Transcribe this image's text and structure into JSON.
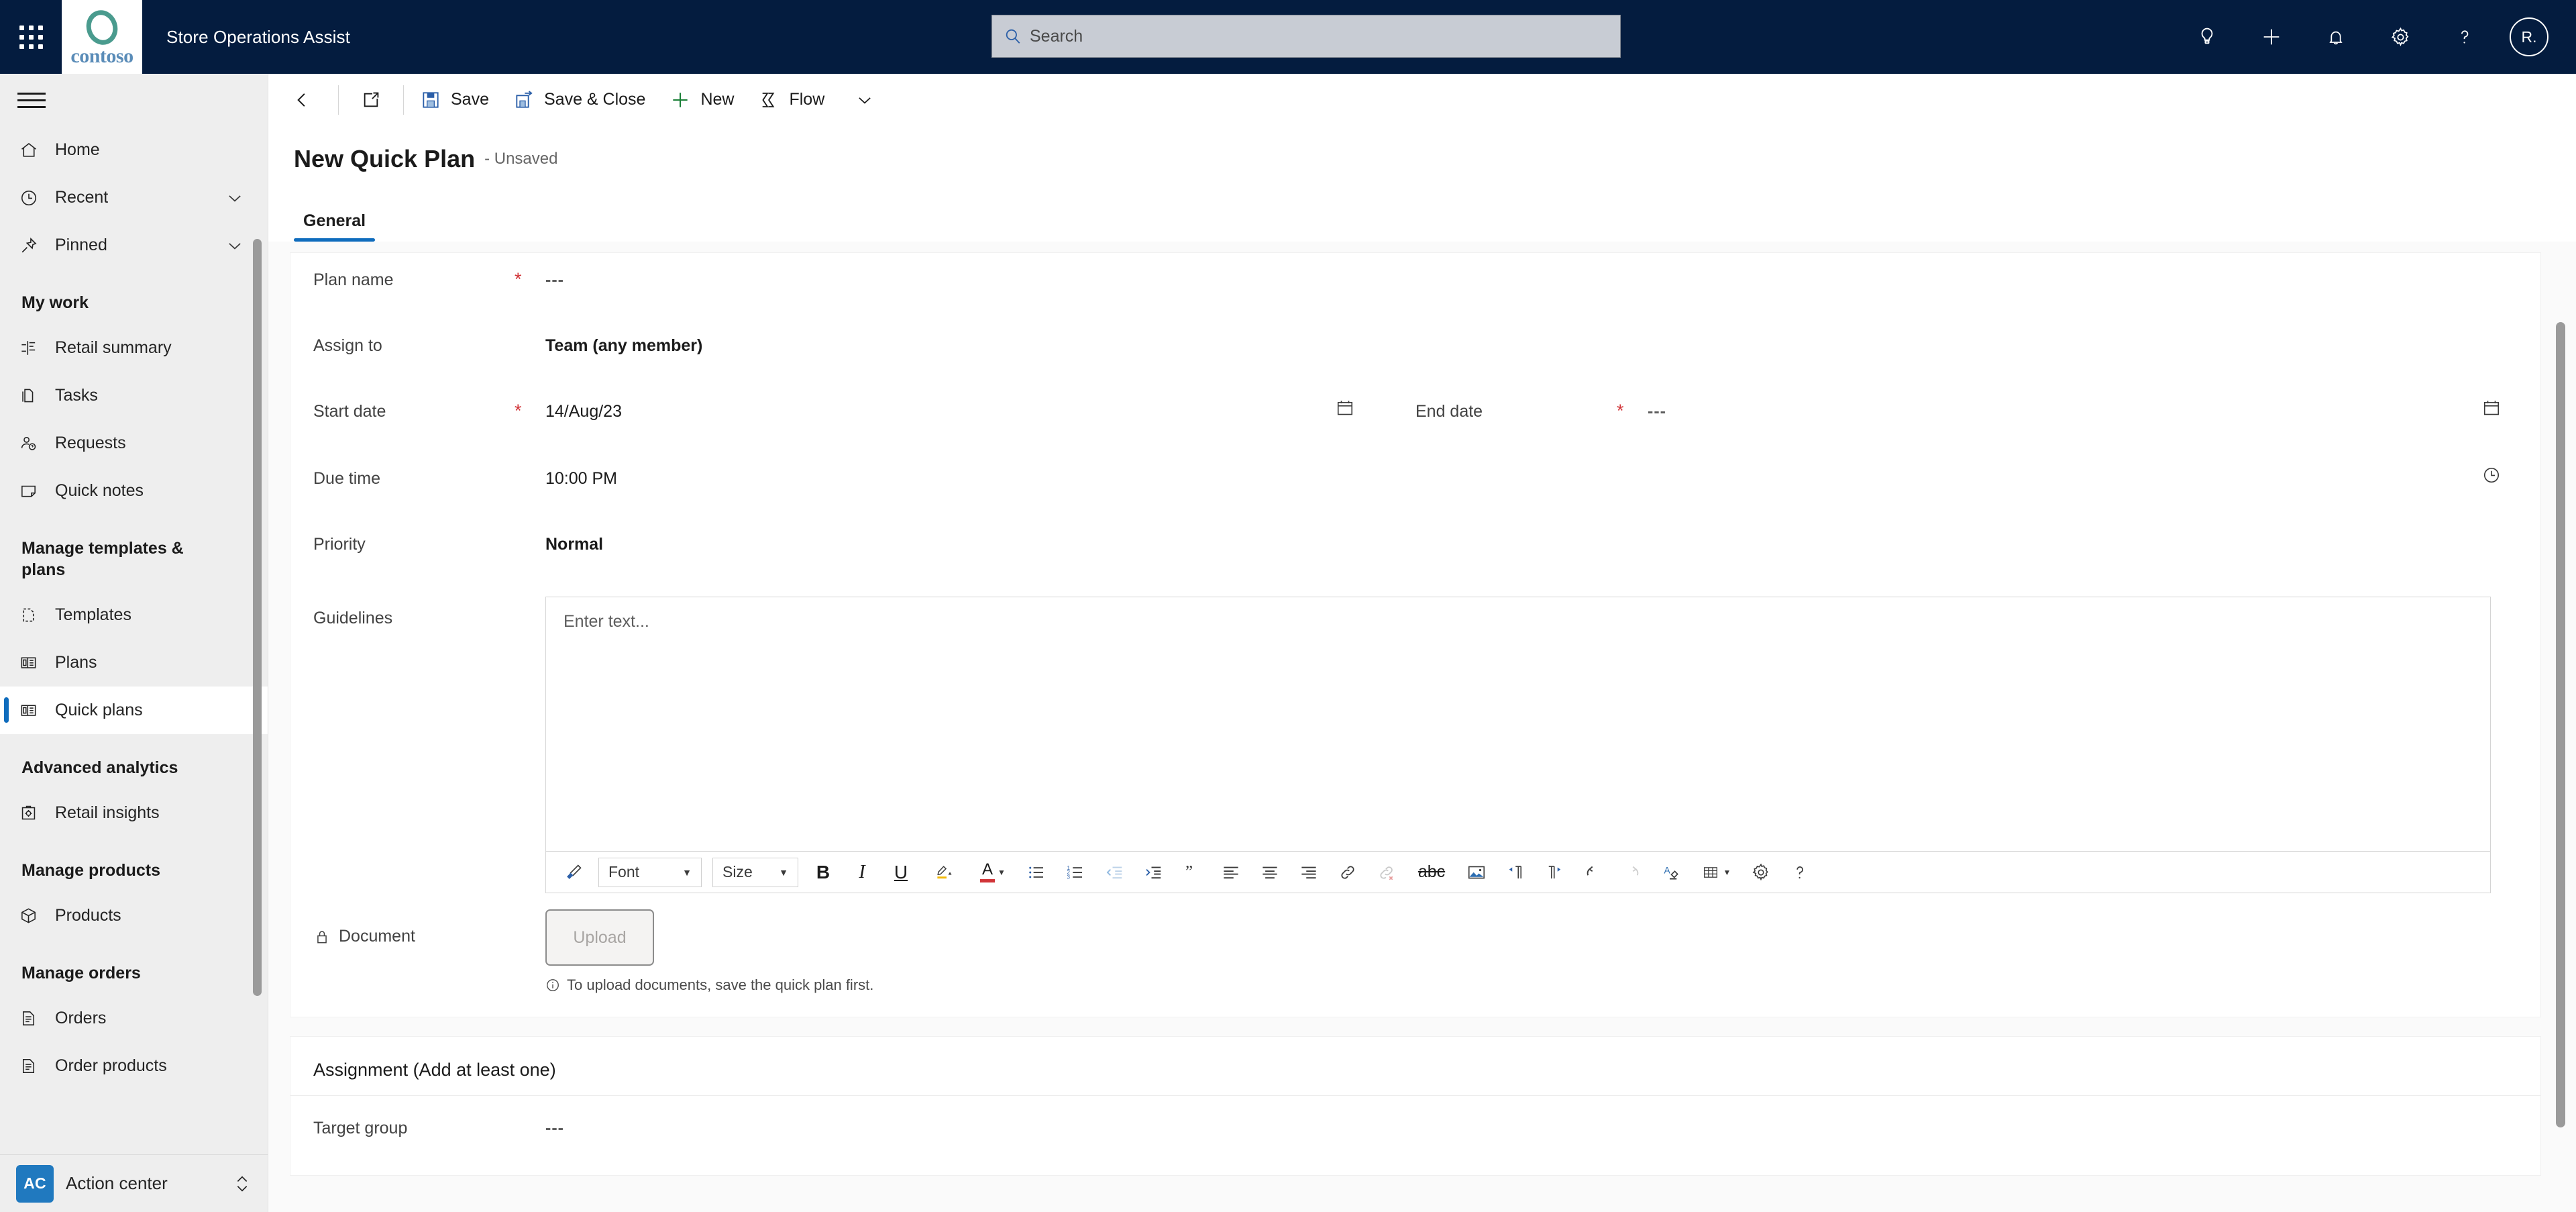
{
  "header": {
    "app_title": "Store Operations Assist",
    "brand_wordmark": "contoso",
    "search_placeholder": "Search",
    "waffle_icon": "app-launcher-icon",
    "search_icon": "search-icon",
    "actions": [
      {
        "name": "lightbulb-icon",
        "label": "Insights"
      },
      {
        "name": "plus-icon",
        "label": "Quick create"
      },
      {
        "name": "bell-icon",
        "label": "Notifications"
      },
      {
        "name": "gear-icon",
        "label": "Settings"
      },
      {
        "name": "question-icon",
        "label": "Help"
      }
    ],
    "avatar_initials": "R."
  },
  "sidebar": {
    "menu_icon": "hamburger-icon",
    "top_items": [
      {
        "label": "Home",
        "icon": "home-icon",
        "expandable": false
      },
      {
        "label": "Recent",
        "icon": "clock-icon",
        "expandable": true
      },
      {
        "label": "Pinned",
        "icon": "pin-icon",
        "expandable": true
      }
    ],
    "groups": [
      {
        "title": "My work",
        "items": [
          {
            "label": "Retail summary",
            "icon": "chart-summary-icon"
          },
          {
            "label": "Tasks",
            "icon": "tasks-icon"
          },
          {
            "label": "Requests",
            "icon": "requests-icon"
          },
          {
            "label": "Quick notes",
            "icon": "note-icon"
          }
        ]
      },
      {
        "title": "Manage templates & plans",
        "items": [
          {
            "label": "Templates",
            "icon": "template-icon"
          },
          {
            "label": "Plans",
            "icon": "plans-icon"
          },
          {
            "label": "Quick plans",
            "icon": "quick-plans-icon",
            "active": true
          }
        ]
      },
      {
        "title": "Advanced analytics",
        "items": [
          {
            "label": "Retail insights",
            "icon": "insights-icon"
          }
        ]
      },
      {
        "title": "Manage products",
        "items": [
          {
            "label": "Products",
            "icon": "box-icon"
          }
        ]
      },
      {
        "title": "Manage orders",
        "items": [
          {
            "label": "Orders",
            "icon": "order-icon"
          },
          {
            "label": "Order products",
            "icon": "order-products-icon"
          }
        ]
      }
    ],
    "action_center": {
      "badge": "AC",
      "label": "Action center",
      "chevron_icon": "chevron-up-down-icon"
    }
  },
  "commandbar": {
    "back_icon": "back-arrow-icon",
    "popout_icon": "open-in-new-window-icon",
    "save_label": "Save",
    "save_icon": "save-floppy-icon",
    "save_close_label": "Save & Close",
    "save_close_icon": "save-and-close-icon",
    "new_label": "New",
    "new_icon": "plus-icon",
    "flow_label": "Flow",
    "flow_icon": "flow-icon",
    "overflow_icon": "chevron-down-icon"
  },
  "page": {
    "title": "New Quick Plan",
    "subtitle": "- Unsaved",
    "tabs": [
      {
        "label": "General",
        "active": true
      }
    ]
  },
  "form": {
    "fields": {
      "plan_name": {
        "label": "Plan name",
        "required": true,
        "value": "---"
      },
      "assign_to": {
        "label": "Assign to",
        "required": false,
        "value": "Team (any member)"
      },
      "start_date": {
        "label": "Start date",
        "required": true,
        "value": "14/Aug/23",
        "icon": "calendar-icon"
      },
      "end_date": {
        "label": "End date",
        "required": true,
        "value": "---",
        "icon": "calendar-icon"
      },
      "due_time": {
        "label": "Due time",
        "required": false,
        "value": "10:00 PM",
        "icon": "clock-icon"
      },
      "priority": {
        "label": "Priority",
        "required": false,
        "value": "Normal"
      },
      "guidelines": {
        "label": "Guidelines",
        "required": false,
        "placeholder": "Enter text..."
      }
    },
    "document": {
      "label": "Document",
      "lock_icon": "lock-icon",
      "upload_label": "Upload",
      "upload_disabled": true,
      "note": "To upload documents, save the quick plan first.",
      "note_icon": "info-icon"
    },
    "assignment": {
      "section_title": "Assignment (Add at least one)",
      "target_group": {
        "label": "Target group",
        "value": "---"
      }
    }
  },
  "editor_toolbar": {
    "font_label": "Font",
    "size_label": "Size",
    "bold_label": "B",
    "italic_label": "I",
    "underline_label": "U",
    "font_color_label": "A",
    "strike_label": "abc",
    "buttons": [
      {
        "name": "format-painter-icon"
      },
      {
        "name": "bold-icon"
      },
      {
        "name": "italic-icon"
      },
      {
        "name": "underline-icon"
      },
      {
        "name": "highlight-icon"
      },
      {
        "name": "font-color-icon"
      },
      {
        "name": "bulleted-list-icon"
      },
      {
        "name": "numbered-list-icon"
      },
      {
        "name": "decrease-indent-icon"
      },
      {
        "name": "increase-indent-icon"
      },
      {
        "name": "blockquote-icon"
      },
      {
        "name": "align-left-icon"
      },
      {
        "name": "align-center-icon"
      },
      {
        "name": "align-right-icon"
      },
      {
        "name": "link-icon"
      },
      {
        "name": "unlink-icon"
      },
      {
        "name": "strikethrough-icon"
      },
      {
        "name": "insert-image-icon"
      },
      {
        "name": "ltr-icon"
      },
      {
        "name": "rtl-icon"
      },
      {
        "name": "undo-icon"
      },
      {
        "name": "redo-icon"
      },
      {
        "name": "clear-formatting-icon"
      },
      {
        "name": "table-icon"
      },
      {
        "name": "editor-settings-icon"
      },
      {
        "name": "editor-help-icon"
      }
    ]
  },
  "colors": {
    "header_bg": "#041c3f",
    "accent": "#0f6cbd",
    "required": "#d13438",
    "sidebar_bg": "#eeeeee",
    "badge_blue": "#2079bf",
    "brand_teal": "#4a9b8e",
    "brand_blue": "#5a8cb8"
  }
}
